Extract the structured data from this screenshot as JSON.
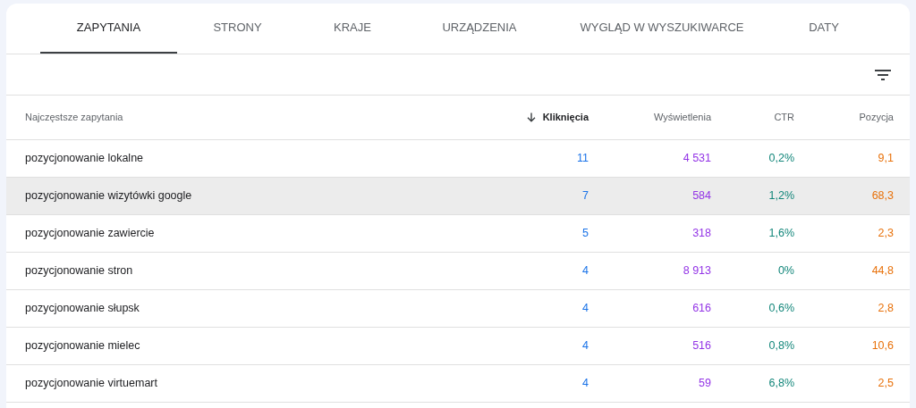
{
  "tabs": [
    {
      "label": "ZAPYTANIA",
      "selected": true
    },
    {
      "label": "STRONY",
      "selected": false
    },
    {
      "label": "KRAJE",
      "selected": false
    },
    {
      "label": "URZĄDZENIA",
      "selected": false
    },
    {
      "label": "WYGLĄD W WYSZUKIWARCE",
      "selected": false
    },
    {
      "label": "DATY",
      "selected": false
    }
  ],
  "table": {
    "columns": [
      {
        "label": "Najczęstsze zapytania",
        "sorted": false
      },
      {
        "label": "Kliknięcia",
        "sorted": true
      },
      {
        "label": "Wyświetlenia",
        "sorted": false
      },
      {
        "label": "CTR",
        "sorted": false
      },
      {
        "label": "Pozycja",
        "sorted": false
      }
    ],
    "rows": [
      {
        "cells": [
          "pozycjonowanie lokalne",
          "11",
          "4 531",
          "0,2%",
          "9,1"
        ],
        "highlighted": false
      },
      {
        "cells": [
          "pozycjonowanie wizytówki google",
          "7",
          "584",
          "1,2%",
          "68,3"
        ],
        "highlighted": true
      },
      {
        "cells": [
          "pozycjonowanie zawiercie",
          "5",
          "318",
          "1,6%",
          "2,3"
        ],
        "highlighted": false
      },
      {
        "cells": [
          "pozycjonowanie stron",
          "4",
          "8 913",
          "0%",
          "44,8"
        ],
        "highlighted": false
      },
      {
        "cells": [
          "pozycjonowanie słupsk",
          "4",
          "616",
          "0,6%",
          "2,8"
        ],
        "highlighted": false
      },
      {
        "cells": [
          "pozycjonowanie mielec",
          "4",
          "516",
          "0,8%",
          "10,6"
        ],
        "highlighted": false
      },
      {
        "cells": [
          "pozycjonowanie virtuemart",
          "4",
          "59",
          "6,8%",
          "2,5"
        ],
        "highlighted": false
      }
    ]
  }
}
